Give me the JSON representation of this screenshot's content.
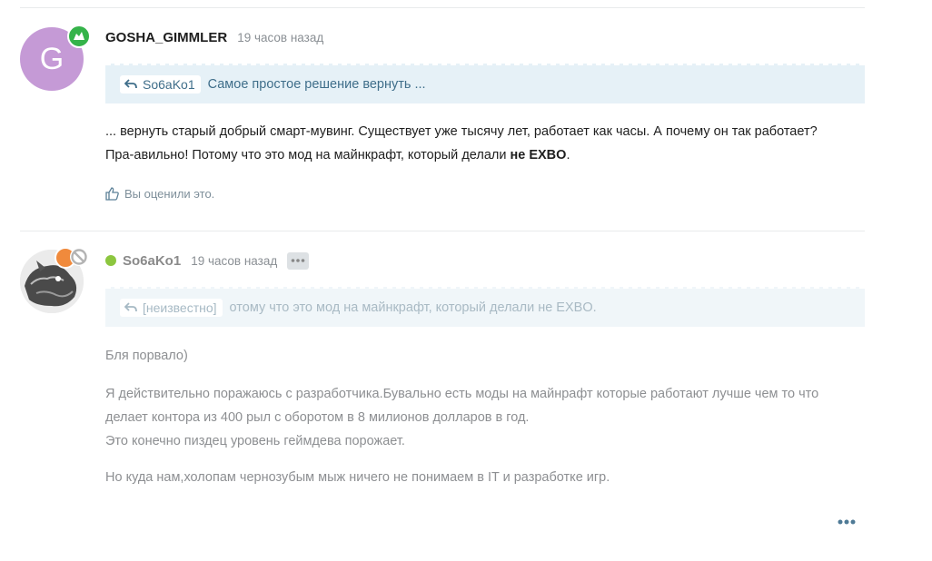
{
  "post1": {
    "avatar_letter": "G",
    "username": "GOSHA_GIMMLER",
    "time": "19 часов назад",
    "quote": {
      "author": "So6aKo1",
      "text": "Самое простое решение вернуть ..."
    },
    "message": {
      "line1": "... вернуть старый добрый смарт-мувинг. Существует уже тысячу лет, работает как часы. А почему он так работает?",
      "line2_start": "Пра-авильно! Потому что это мод на майнкрафт, который делали ",
      "line2_bold": "не EXBO",
      "line2_end": "."
    },
    "reaction_text": "Вы оценили это."
  },
  "post2": {
    "username": "So6aKo1",
    "time": "19 часов назад",
    "quote": {
      "author": "[неизвестно]",
      "text": "отому что это мод на майнкрафт, который делали не EXBO."
    },
    "paragraphs": {
      "p1": "Бля порвало)",
      "p2_line1": "Я действительно поражаюсь с разработчика.Бувально есть моды на майнрафт которые работают лучше чем то что",
      "p2_line2": "делает контора из 400 рыл с оборотом в 8 милионов долларов в год.",
      "p2_line3": "Это конечно пиздец уровень геймдева порожает.",
      "p3": "Но куда нам,холопам чернозубым мыж ничего не понимаем в IT и разработке игр."
    }
  },
  "colors": {
    "accent": "#3f6e8a",
    "online": "#8cc63f",
    "badge_green": "#35b34a",
    "avatar_purple": "#c59ad6"
  }
}
